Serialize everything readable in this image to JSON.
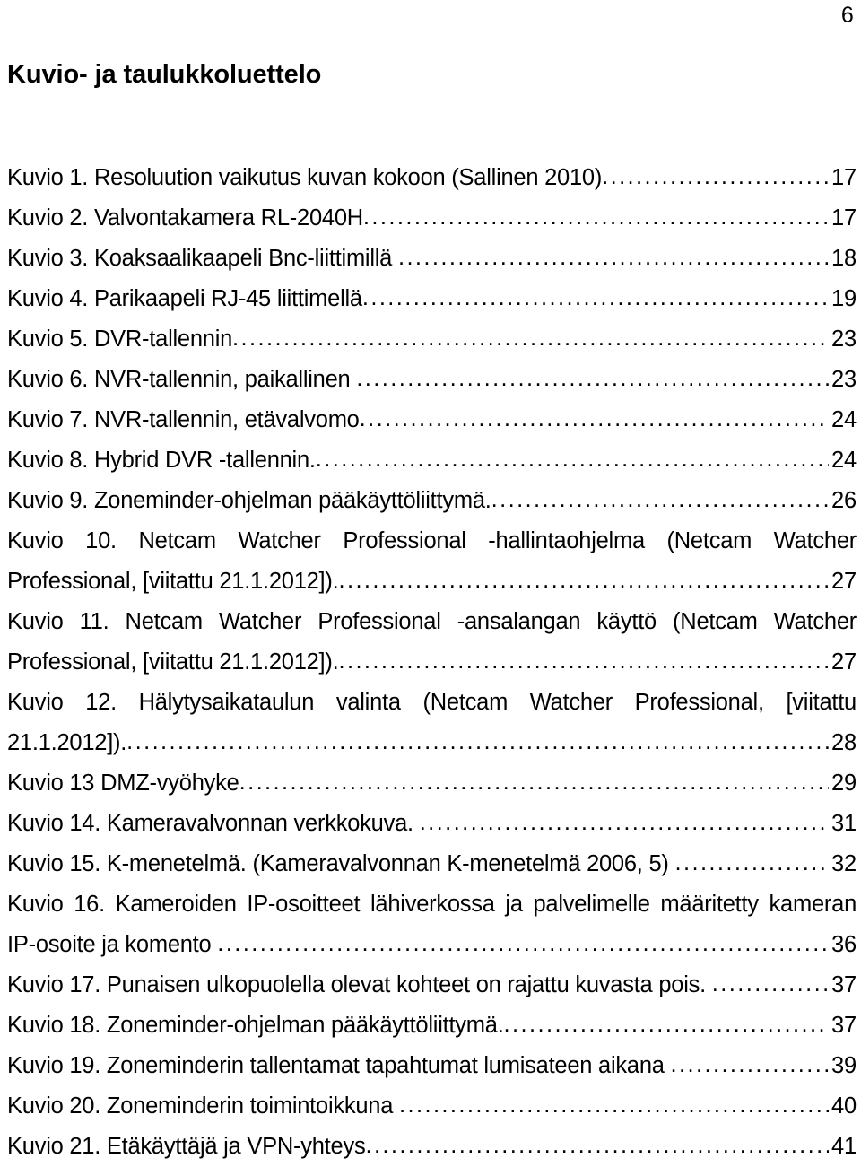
{
  "page": {
    "number": "6",
    "heading": "Kuvio- ja taulukkoluettelo"
  },
  "toc": {
    "entries": [
      {
        "id": "kuvio-1",
        "lines": [
          {
            "text": "Kuvio 1. Resoluution vaikutus kuvan kokoon (Sallinen 2010)",
            "justified": false
          }
        ],
        "page": "17"
      },
      {
        "id": "kuvio-2",
        "lines": [
          {
            "text": "Kuvio 2. Valvontakamera RL-2040H",
            "justified": false
          }
        ],
        "page": "17"
      },
      {
        "id": "kuvio-3",
        "lines": [
          {
            "text": "Kuvio 3. Koaksaalikaapeli Bnc-liittimillä ",
            "justified": false
          }
        ],
        "page": "18"
      },
      {
        "id": "kuvio-4",
        "lines": [
          {
            "text": "Kuvio 4. Parikaapeli RJ-45 liittimellä",
            "justified": false
          }
        ],
        "page": "19"
      },
      {
        "id": "kuvio-5",
        "lines": [
          {
            "text": "Kuvio 5. DVR-tallennin",
            "justified": false
          }
        ],
        "page": "23"
      },
      {
        "id": "kuvio-6",
        "lines": [
          {
            "text": "Kuvio 6. NVR-tallennin, paikallinen ",
            "justified": false
          }
        ],
        "page": "23"
      },
      {
        "id": "kuvio-7",
        "lines": [
          {
            "text": "Kuvio 7. NVR-tallennin, etävalvomo",
            "justified": false
          }
        ],
        "page": "24"
      },
      {
        "id": "kuvio-8",
        "lines": [
          {
            "text": "Kuvio 8. Hybrid DVR -tallennin.",
            "justified": false
          }
        ],
        "page": "24"
      },
      {
        "id": "kuvio-9",
        "lines": [
          {
            "text": "Kuvio 9. Zoneminder-ohjelman pääkäyttöliittymä.",
            "justified": false
          }
        ],
        "page": "26"
      },
      {
        "id": "kuvio-10",
        "lines": [
          {
            "text": "Kuvio 10. Netcam Watcher Professional -hallintaohjelma (Netcam Watcher",
            "justified": true
          },
          {
            "text": "Professional, [viitattu 21.1.2012]).",
            "justified": false
          }
        ],
        "page": "27"
      },
      {
        "id": "kuvio-11",
        "lines": [
          {
            "text": "Kuvio 11. Netcam Watcher Professional -ansalangan käyttö (Netcam Watcher",
            "justified": true
          },
          {
            "text": "Professional, [viitattu 21.1.2012]).",
            "justified": false
          }
        ],
        "page": "27"
      },
      {
        "id": "kuvio-12",
        "lines": [
          {
            "text": "Kuvio 12. Hälytysaikataulun valinta (Netcam Watcher Professional, [viitattu",
            "justified": true
          },
          {
            "text": "21.1.2012]).",
            "justified": false
          }
        ],
        "page": "28"
      },
      {
        "id": "kuvio-13",
        "lines": [
          {
            "text": "Kuvio 13 DMZ-vyöhyke",
            "justified": false
          }
        ],
        "page": "29"
      },
      {
        "id": "kuvio-14",
        "lines": [
          {
            "text": "Kuvio 14. Kameravalvonnan verkkokuva. ",
            "justified": false
          }
        ],
        "page": "31"
      },
      {
        "id": "kuvio-15",
        "lines": [
          {
            "text": "Kuvio 15. K-menetelmä. (Kameravalvonnan K-menetelmä 2006, 5) ",
            "justified": false
          }
        ],
        "page": "32"
      },
      {
        "id": "kuvio-16",
        "lines": [
          {
            "text": "Kuvio 16. Kameroiden IP-osoitteet lähiverkossa ja palvelimelle määritetty kameran",
            "justified": true
          },
          {
            "text": "IP-osoite ja komento ",
            "justified": false
          }
        ],
        "page": "36"
      },
      {
        "id": "kuvio-17",
        "lines": [
          {
            "text": "Kuvio 17. Punaisen ulkopuolella olevat kohteet on rajattu kuvasta pois. ",
            "justified": false
          }
        ],
        "page": "37"
      },
      {
        "id": "kuvio-18",
        "lines": [
          {
            "text": "Kuvio 18. Zoneminder-ohjelman pääkäyttöliittymä.",
            "justified": false
          }
        ],
        "page": "37"
      },
      {
        "id": "kuvio-19",
        "lines": [
          {
            "text": "Kuvio 19. Zoneminderin tallentamat tapahtumat lumisateen aikana ",
            "justified": false
          }
        ],
        "page": "39"
      },
      {
        "id": "kuvio-20",
        "lines": [
          {
            "text": "Kuvio 20. Zoneminderin toimintoikkuna ",
            "justified": false
          }
        ],
        "page": "40"
      },
      {
        "id": "kuvio-21",
        "lines": [
          {
            "text": "Kuvio 21. Etäkäyttäjä ja VPN-yhteys",
            "justified": false
          }
        ],
        "page": "41"
      }
    ],
    "leader_char": "."
  }
}
